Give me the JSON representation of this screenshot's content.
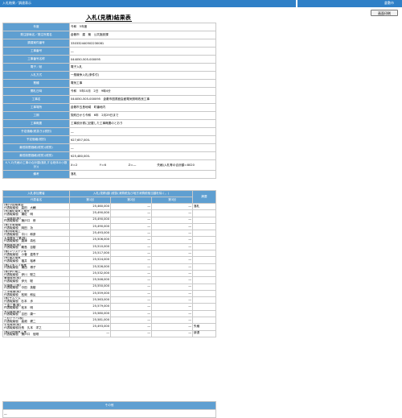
{
  "header": {
    "left_text": "入札結果／調達表示",
    "right_text": "倉敷市",
    "print_label": "画面印刷"
  },
  "title": "入札(見積)結果表",
  "detail_rows": [
    {
      "label": "年度",
      "value": "令和　5年度"
    },
    {
      "label": "発注部局名／発注所属名",
      "value": "倉敷市　建　築　公共施設課"
    },
    {
      "label": "調達案件番号",
      "value": "330332440502230081"
    },
    {
      "label": "工事番号",
      "value": "―"
    },
    {
      "label": "工事番号名称",
      "value": "044050-505-000095"
    },
    {
      "label": "電子／紙",
      "value": "電子入札"
    },
    {
      "label": "入札方式",
      "value": "一般競争入札(条件付)"
    },
    {
      "label": "業種",
      "value": "電気工事"
    },
    {
      "label": "開札日時",
      "value": "令和　5年10月　2日　9時4分"
    },
    {
      "label": "工事名",
      "value": "044050-505-000095　倉敷市図書館会館電気照明改良工事"
    },
    {
      "label": "工事場所",
      "value": "倉敷市玉島地域　町番地内"
    },
    {
      "label": "工期",
      "value": "契約日から令和　6年　2月29日まで"
    },
    {
      "label": "工事概要",
      "value": "工事設計書に記載した工事概要のとおり"
    },
    {
      "label": "予定価格(税抜き)(税別)",
      "value": "―"
    },
    {
      "label": "予定価格(税別)",
      "value": "¥27,657,000-"
    },
    {
      "label": "最低制限価格(税別)(税別)",
      "value": "―"
    },
    {
      "label": "最低制限価格(税別)(税別)",
      "value": "¥25,480,000-"
    }
  ],
  "xyz_row": {
    "label": "X,Y,Z(失格の工事の合計額(落札する総体の小数計))",
    "x": "X＝2",
    "y": "Y＝6",
    "z": "Z＝―",
    "note": "失格(入札等の合計額＝8020"
  },
  "remarks_row": {
    "label": "備考",
    "value": "落札"
  },
  "bids": {
    "headers": {
      "bidder": "入札参加業者",
      "rep": "代表者名",
      "amount": "入札(見積)額 (税抜(消費税及び地方消費税相当額を除く。)",
      "round1": "第1回",
      "round2": "第2回",
      "round3": "第3回",
      "status": "摘要"
    },
    "rows": [
      {
        "company": "(株)中国電業会",
        "rep": "代表取締役　高田　大輔",
        "r1": "25,460,000",
        "r2": "―",
        "r3": "―",
        "status": "落札"
      },
      {
        "company": "(有)瀬佐電気工業所",
        "rep": "代表取締役　瀬佐　明",
        "r1": "25,490,000",
        "r2": "―",
        "r3": "―",
        "status": ""
      },
      {
        "company": "三弥電設(株)",
        "rep": "代表取締役　捕戸口　修",
        "r1": "25,490,000",
        "r2": "―",
        "r3": "―",
        "status": ""
      },
      {
        "company": "(株)宇電電機",
        "rep": "代表取締役　岡田　功",
        "r1": "25,490,000",
        "r2": "―",
        "r3": "―",
        "status": ""
      },
      {
        "company": "(株)明電電工",
        "rep": "代表取締役　平川　和彦",
        "r1": "25,493,000",
        "r2": "―",
        "r3": "―",
        "status": ""
      },
      {
        "company": "大島電気工業(株)",
        "rep": "代表取締役　唐津　真也",
        "r1": "25,506,000",
        "r2": "―",
        "r3": "―",
        "status": ""
      },
      {
        "company": "鳴西電気(株)",
        "rep": "代表取締役　難島　百樹",
        "r1": "25,510,000",
        "r2": "―",
        "r3": "―",
        "status": ""
      },
      {
        "company": "(株)ユウスデンキ",
        "rep": "代表取締役　小菅　嘉寿子",
        "r1": "25,517,000",
        "r2": "―",
        "r3": "―",
        "status": ""
      },
      {
        "company": "(有)福井電気",
        "rep": "代表取締役　福井　裕孝",
        "r1": "25,524,000",
        "r2": "―",
        "r3": "―",
        "status": ""
      },
      {
        "company": "(株)マキシマ電業",
        "rep": "代表取締役　瀬西　博子",
        "r1": "25,526,000",
        "r2": "―",
        "r3": "―",
        "status": ""
      },
      {
        "company": "(株)伊川電工",
        "rep": "代表取締役　伊川　聡之",
        "r1": "25,532,000",
        "r2": "―",
        "r3": "―",
        "status": ""
      },
      {
        "company": "東陽電気(株)",
        "rep": "代表取締役　伊元　聡",
        "r1": "25,546,000",
        "r2": "―",
        "r3": "―",
        "status": ""
      },
      {
        "company": "中国電工(株)",
        "rep": "代表取締役　中田　英樹",
        "r1": "25,550,000",
        "r2": "―",
        "r3": "―",
        "status": ""
      },
      {
        "company": "三洋電業(株)",
        "rep": "代表取締役　松岡　和弘",
        "r1": "25,559,000",
        "r2": "―",
        "r3": "―",
        "status": ""
      },
      {
        "company": "(株)サムソム",
        "rep": "代表取締役　杉本　歩",
        "r1": "25,563,000",
        "r2": "―",
        "r3": "―",
        "status": ""
      },
      {
        "company": "三金工業(株)",
        "rep": "代表取締役　松本　明",
        "r1": "25,579,000",
        "r2": "―",
        "r3": "―",
        "status": ""
      },
      {
        "company": "大日電気(株)",
        "rep": "代表取締役　吉田　康一",
        "r1": "25,580,000",
        "r2": "―",
        "r3": "―",
        "status": ""
      },
      {
        "company": "三杉デテハ(株)",
        "rep": "代表取締役　高畑　健二",
        "r1": "25,581,000",
        "r2": "―",
        "r3": "―",
        "status": ""
      },
      {
        "company": "平成電気(株)",
        "rep": "代表取締役社長　久本　洋之",
        "r1": "25,493,000",
        "r2": "―",
        "r3": "―",
        "status": "失格"
      },
      {
        "company": "(株)中西電気工業",
        "rep": "代表取締役　捕戸口　信剛",
        "r1": "―",
        "r2": "―",
        "r3": "―",
        "status": "辞退"
      }
    ]
  },
  "other": {
    "header": "その他",
    "value": "―"
  }
}
